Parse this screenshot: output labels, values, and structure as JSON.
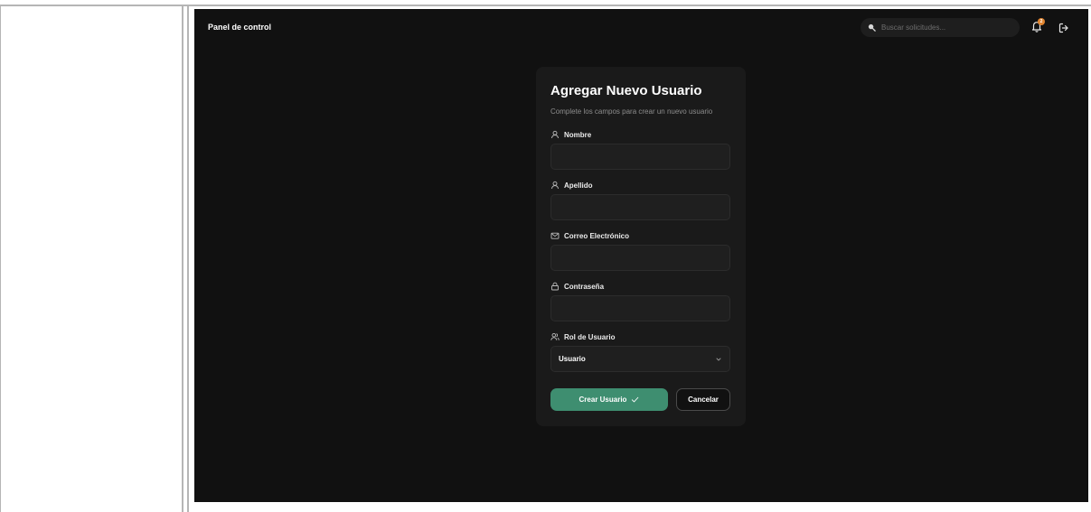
{
  "header": {
    "title": "Panel de control",
    "search_placeholder": "Buscar solicitudes...",
    "notification_count": "2",
    "icons": {
      "search": "search-icon",
      "notifications": "bell-icon",
      "logout": "logout-icon"
    }
  },
  "form": {
    "title": "Agregar Nuevo Usuario",
    "subtitle": "Complete los campos para crear un nuevo usuario",
    "fields": [
      {
        "label": "Nombre",
        "value": "",
        "icon": "user-icon"
      },
      {
        "label": "Apellido",
        "value": "",
        "icon": "user-icon"
      },
      {
        "label": "Correo Electrónico",
        "value": "",
        "icon": "mail-icon"
      },
      {
        "label": "Contraseña",
        "value": "",
        "icon": "lock-icon"
      }
    ],
    "role": {
      "label": "Rol de Usuario",
      "selected": "Usuario",
      "icon": "users-icon"
    },
    "submit_label": "Crear Usuario",
    "cancel_label": "Cancelar"
  },
  "colors": {
    "background": "#111111",
    "card": "#1a1a1a",
    "input": "#1f1f1f",
    "primary": "#3e8e70",
    "badge": "#e0842f"
  }
}
